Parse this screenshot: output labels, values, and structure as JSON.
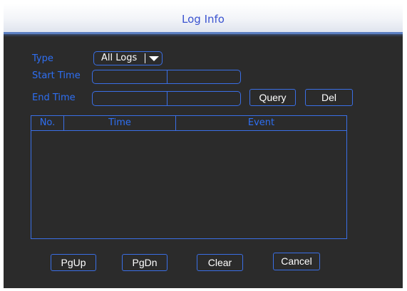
{
  "title": "Log Info",
  "type_label": "Type",
  "type_value": "All Logs",
  "start_time_label": "Start  Time",
  "end_time_label": "End Time",
  "buttons": {
    "query": "Query",
    "del": "Del",
    "pgup": "PgUp",
    "pgdn": "PgDn",
    "clear": "Clear",
    "cancel": "Cancel"
  },
  "table": {
    "columns": [
      "No.",
      "Time",
      "Event"
    ],
    "rows": []
  },
  "colors": {
    "accent": "#3a6fe6",
    "label": "#2e6ff3",
    "background": "#2b2b2b",
    "title": "#3a53d0"
  }
}
